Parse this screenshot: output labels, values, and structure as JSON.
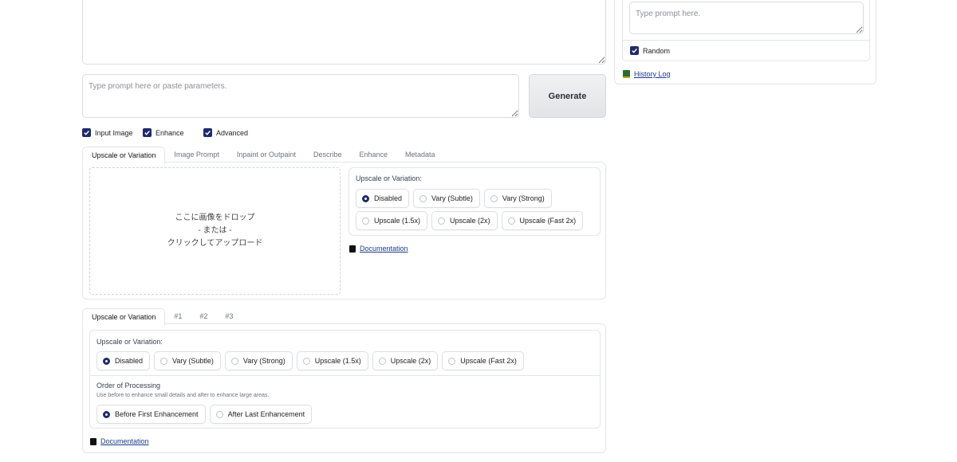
{
  "prompt": {
    "placeholder": "Type prompt here or paste parameters.",
    "generate_label": "Generate"
  },
  "right_panel": {
    "prompt_placeholder": "Type prompt here.",
    "random_label": "Random",
    "history_label": "History Log"
  },
  "toggles": [
    {
      "label": "Input Image",
      "checked": true
    },
    {
      "label": "Enhance",
      "checked": true
    },
    {
      "label": "Advanced",
      "checked": true
    }
  ],
  "input_tabs": [
    "Upscale or Variation",
    "Image Prompt",
    "Inpaint or Outpaint",
    "Describe",
    "Enhance",
    "Metadata"
  ],
  "dropzone": {
    "line1": "ここに画像をドロップ",
    "line2": "- または -",
    "line3": "クリックしてアップロード"
  },
  "uov": {
    "label": "Upscale or Variation:",
    "options_row1": [
      "Disabled",
      "Vary (Subtle)",
      "Vary (Strong)"
    ],
    "options_row2": [
      "Upscale (1.5x)",
      "Upscale (2x)",
      "Upscale (Fast 2x)"
    ],
    "selected": "Disabled",
    "doc_label": "Documentation"
  },
  "enhance_tabs": [
    "Upscale or Variation",
    "#1",
    "#2",
    "#3"
  ],
  "enhance": {
    "label": "Upscale or Variation:",
    "options": [
      "Disabled",
      "Vary (Subtle)",
      "Vary (Strong)",
      "Upscale (1.5x)",
      "Upscale (2x)",
      "Upscale (Fast 2x)"
    ],
    "selected": "Disabled",
    "order_label": "Order of Processing",
    "order_help": "Use before to enhance small details and after to enhance large areas.",
    "order_options": [
      "Before First Enhancement",
      "After Last Enhancement"
    ],
    "order_selected": "Before First Enhancement",
    "doc_label": "Documentation"
  },
  "colors": {
    "accent": "#1f2a6b",
    "border": "#e3e5e8",
    "link": "#1e3a8a"
  }
}
